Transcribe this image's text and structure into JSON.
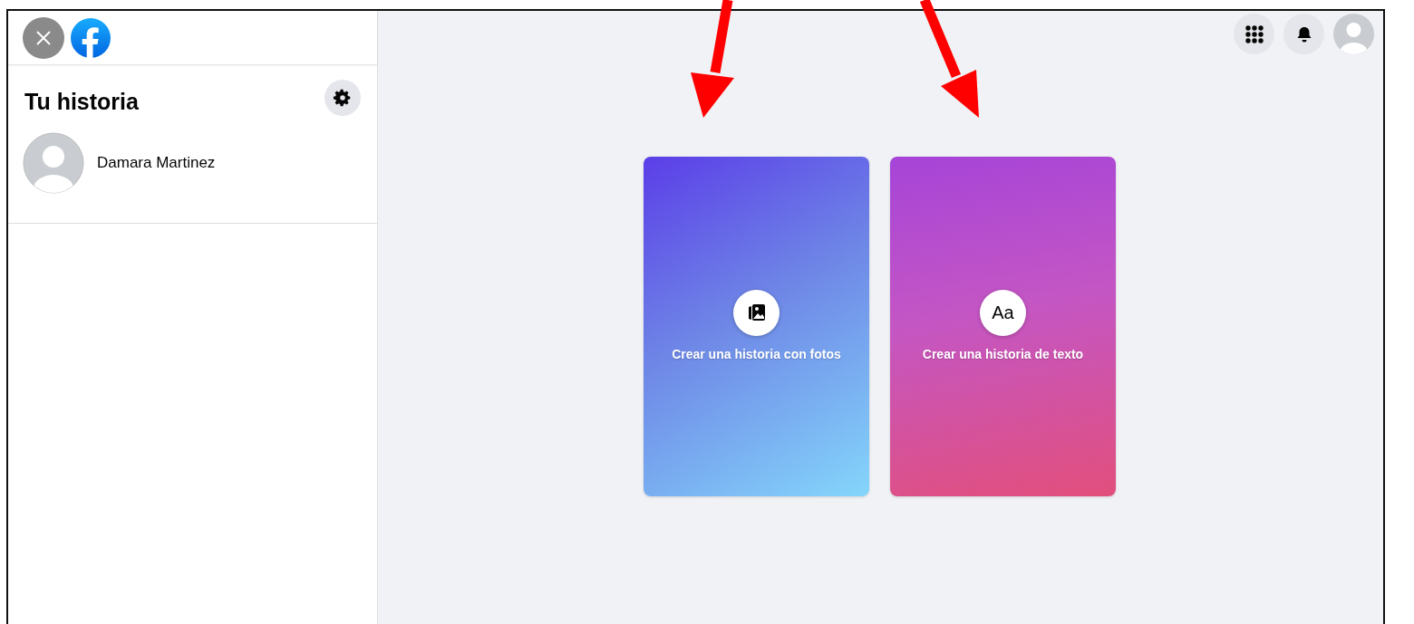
{
  "sidebar": {
    "title": "Tu historia",
    "user": {
      "name": "Damara Martinez"
    }
  },
  "cards": [
    {
      "kind": "photo",
      "label": "Crear una historia con fotos"
    },
    {
      "kind": "text",
      "label": "Crear una historia de texto",
      "icon_text": "Aa"
    }
  ]
}
